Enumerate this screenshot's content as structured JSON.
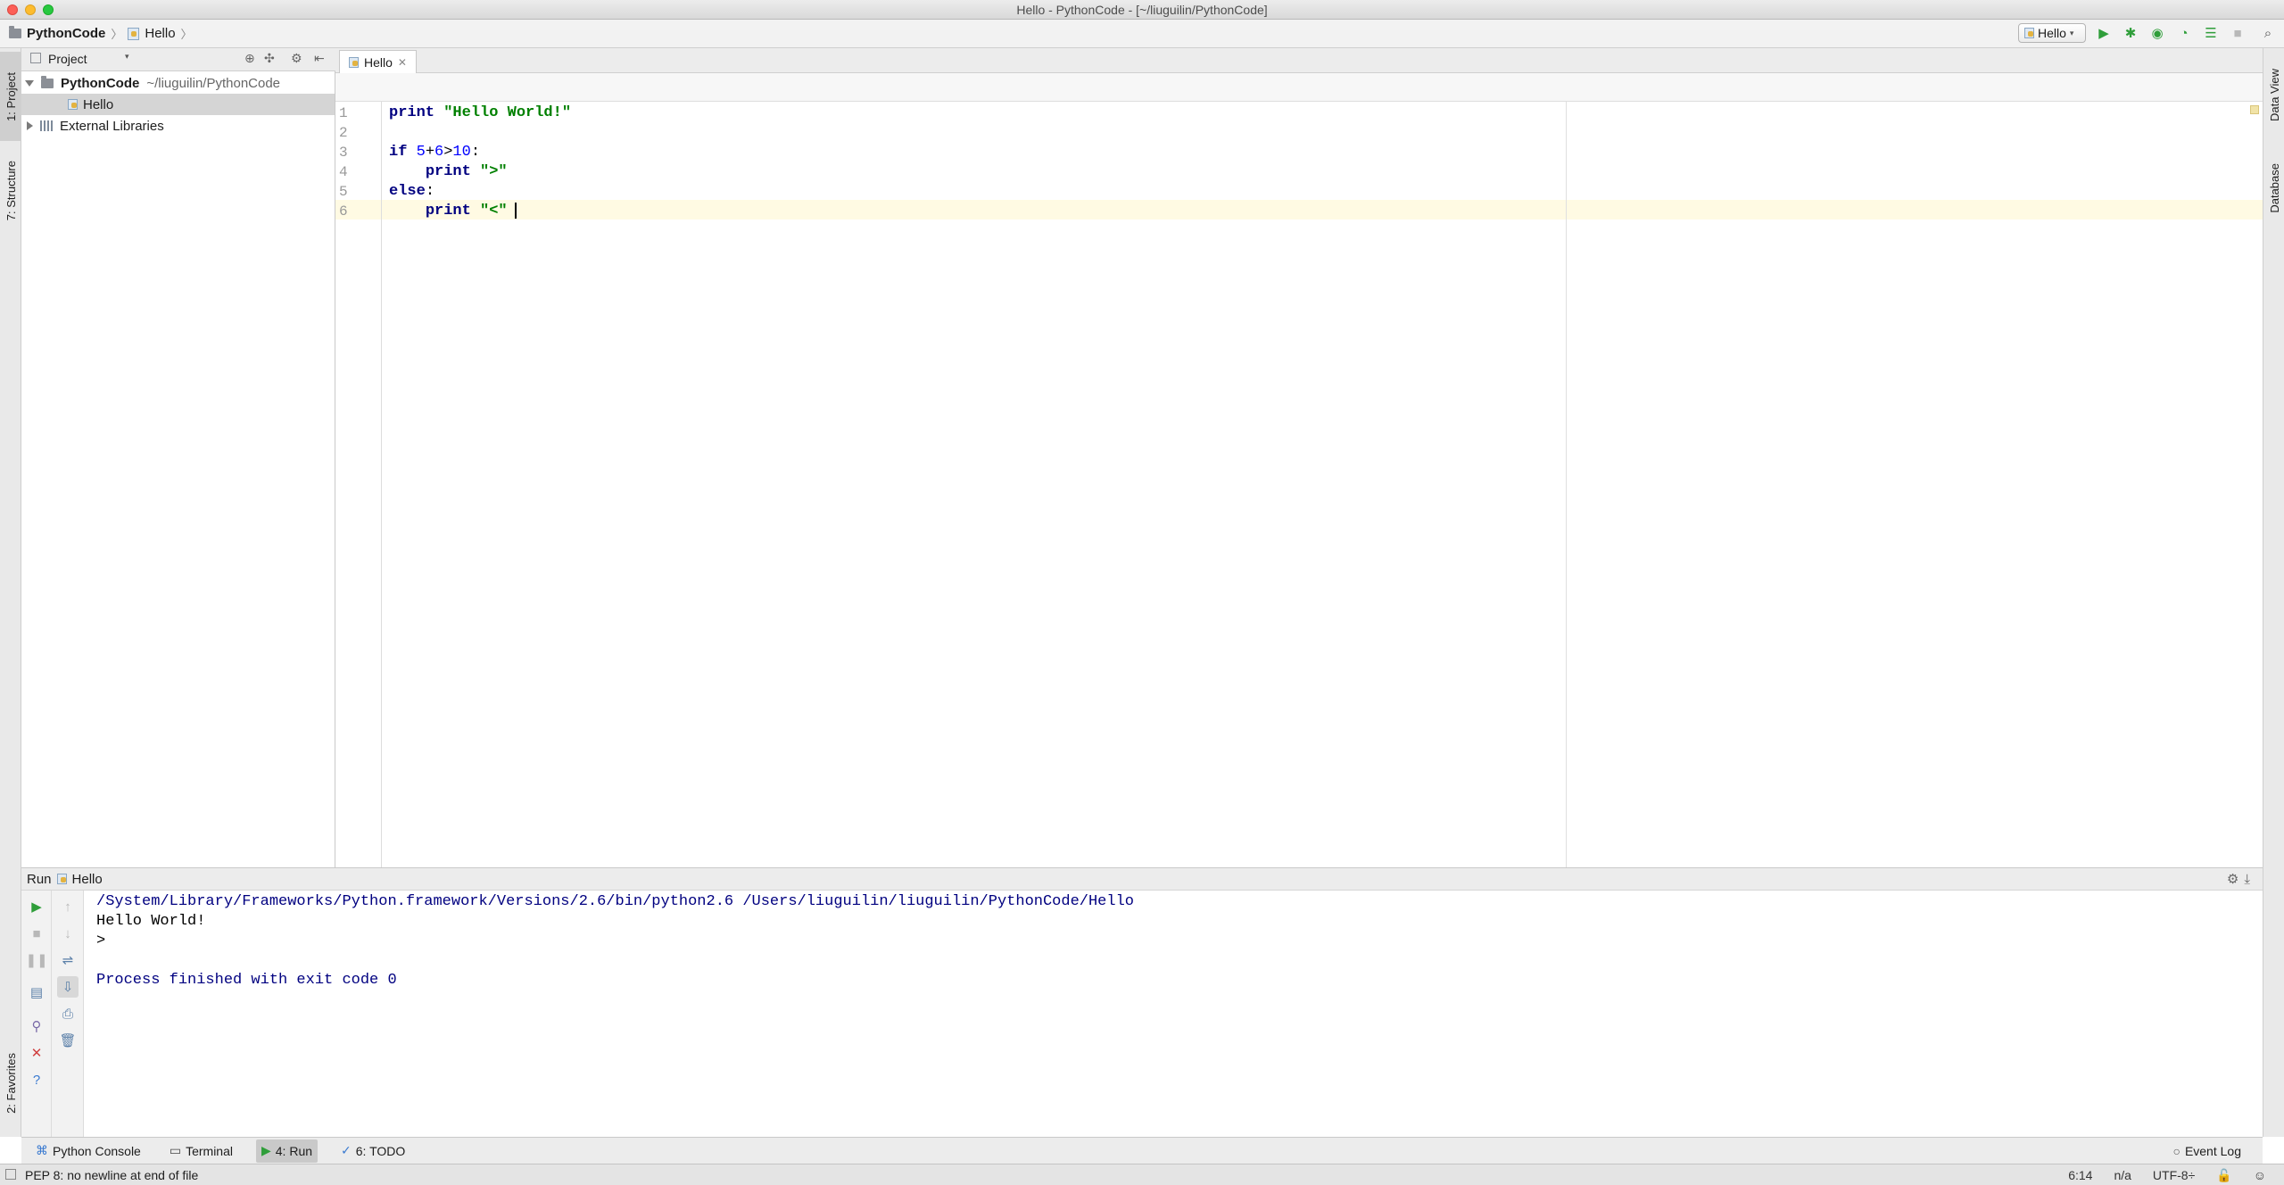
{
  "window": {
    "title": "Hello - PythonCode - [~/liuguilin/PythonCode]"
  },
  "navbar": {
    "project": "PythonCode",
    "file": "Hello",
    "run_config": "Hello"
  },
  "left_strip": {
    "project_tab": "1: Project",
    "structure_tab": "7: Structure",
    "favorites_tab": "2: Favorites"
  },
  "right_strip": {
    "dataview_tab": "Data View",
    "database_tab": "Database"
  },
  "project_panel": {
    "header": "Project",
    "root": {
      "name": "PythonCode",
      "path": "~/liuguilin/PythonCode"
    },
    "child": "Hello",
    "external": "External Libraries"
  },
  "editor": {
    "tab": "Hello",
    "line_numbers": [
      "1",
      "2",
      "3",
      "4",
      "5",
      "6"
    ],
    "lines": [
      [
        {
          "t": "print ",
          "c": "kw"
        },
        {
          "t": "\"Hello World!\"",
          "c": "str"
        }
      ],
      [],
      [
        {
          "t": "if ",
          "c": "kw"
        },
        {
          "t": "5",
          "c": "num"
        },
        {
          "t": "+",
          "c": ""
        },
        {
          "t": "6",
          "c": "num"
        },
        {
          "t": ">",
          "c": ""
        },
        {
          "t": "10",
          "c": "num"
        },
        {
          "t": ":",
          "c": ""
        }
      ],
      [
        {
          "t": "    ",
          "c": ""
        },
        {
          "t": "print ",
          "c": "kw"
        },
        {
          "t": "\">\"",
          "c": "str"
        }
      ],
      [
        {
          "t": "else",
          "c": "kw"
        },
        {
          "t": ":",
          "c": ""
        }
      ],
      [
        {
          "t": "    ",
          "c": ""
        },
        {
          "t": "print ",
          "c": "kw"
        },
        {
          "t": "\"<\"",
          "c": "str"
        }
      ]
    ]
  },
  "run_panel": {
    "label": "Run",
    "config": "Hello",
    "output": [
      "/System/Library/Frameworks/Python.framework/Versions/2.6/bin/python2.6 /Users/liuguilin/liuguilin/PythonCode/Hello",
      "Hello World!",
      ">",
      "",
      "Process finished with exit code 0"
    ]
  },
  "bottom_tools": {
    "python_console": "Python Console",
    "terminal": "Terminal",
    "run": "4: Run",
    "todo": "6: TODO",
    "event_log": "Event Log"
  },
  "statusbar": {
    "message": "PEP 8: no newline at end of file",
    "position": "6:14",
    "line_sep": "n/a",
    "encoding": "UTF-8÷"
  },
  "colors": {
    "run_green": "#2f9e3a",
    "console_blue": "#000080",
    "caret_line": "#fffae3"
  }
}
